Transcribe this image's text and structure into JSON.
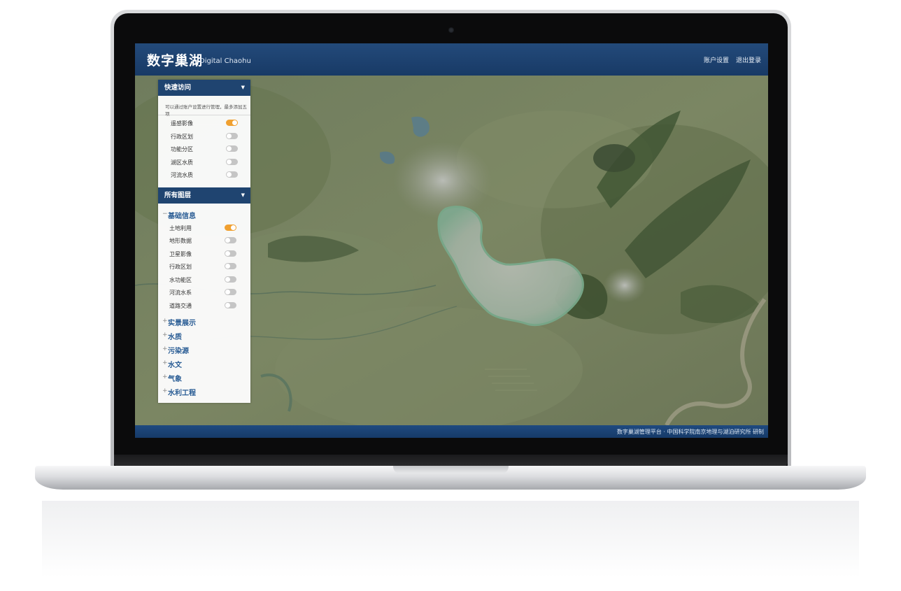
{
  "app": {
    "title_cn": "数字巢湖",
    "title_en": "Digital Chaohu",
    "nav": [
      "账户设置",
      "退出登录"
    ]
  },
  "quick_access": {
    "title": "快速访问",
    "hint": "可以通过账户设置进行管理，最多添加五项",
    "items": [
      {
        "label": "遥感影像",
        "on": true
      },
      {
        "label": "行政区划",
        "on": false
      },
      {
        "label": "功能分区",
        "on": false
      },
      {
        "label": "湖区水质",
        "on": false
      },
      {
        "label": "河流水质",
        "on": false
      }
    ]
  },
  "all_layers": {
    "title": "所有图层",
    "groups": [
      {
        "label": "基础信息",
        "expanded": true,
        "marker": "−",
        "items": [
          {
            "label": "土地利用",
            "on": true
          },
          {
            "label": "地形数据",
            "on": false
          },
          {
            "label": "卫星影像",
            "on": false
          },
          {
            "label": "行政区划",
            "on": false
          },
          {
            "label": "水功能区",
            "on": false
          },
          {
            "label": "河流水系",
            "on": false
          },
          {
            "label": "道路交通",
            "on": false
          }
        ]
      },
      {
        "label": "实景展示",
        "expanded": false,
        "marker": "+"
      },
      {
        "label": "水质",
        "expanded": false,
        "marker": "+"
      },
      {
        "label": "污染源",
        "expanded": false,
        "marker": "+"
      },
      {
        "label": "水文",
        "expanded": false,
        "marker": "+"
      },
      {
        "label": "气象",
        "expanded": false,
        "marker": "+"
      },
      {
        "label": "水利工程",
        "expanded": false,
        "marker": "+"
      }
    ]
  },
  "footer": {
    "text": "数字巢湖管理平台 · 中国科学院南京地理与湖泊研究所 研制"
  },
  "icons": {
    "collapse": "caret-down-icon",
    "toggle_on_color": "#f0a030",
    "toggle_off_color": "#c5c5c5",
    "header_color": "#1f4470"
  }
}
